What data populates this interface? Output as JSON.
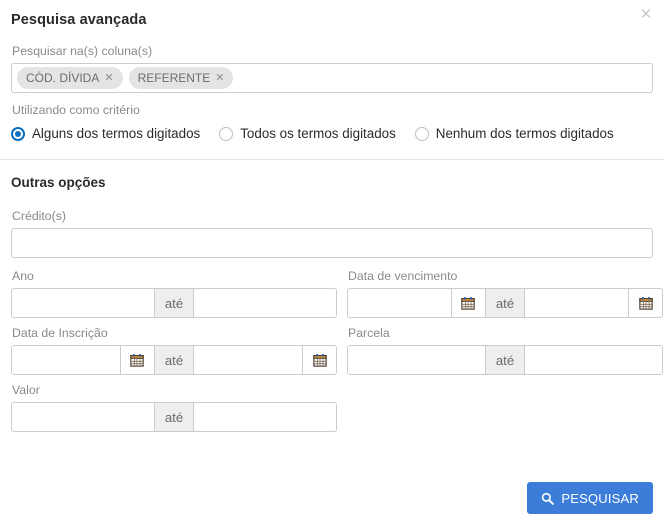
{
  "header": {
    "title": "Pesquisa avançada",
    "close_label": "✕"
  },
  "columns": {
    "label": "Pesquisar na(s) coluna(s)",
    "tags": [
      {
        "label": "CÓD. DÍVIDA",
        "remove": "✕"
      },
      {
        "label": "REFERENTE",
        "remove": "✕"
      }
    ]
  },
  "criteria": {
    "label": "Utilizando como critério",
    "options": [
      {
        "label": "Alguns dos termos digitados",
        "selected": true
      },
      {
        "label": "Todos os termos digitados",
        "selected": false
      },
      {
        "label": "Nenhum dos termos digitados",
        "selected": false
      }
    ]
  },
  "other": {
    "section_title": "Outras opções",
    "credito": {
      "label": "Crédito(s)",
      "value": "",
      "placeholder": ""
    },
    "ano": {
      "label": "Ano",
      "from": "",
      "to": "",
      "separator": "até"
    },
    "data_vencimento": {
      "label": "Data de vencimento",
      "from": "",
      "to": "",
      "separator": "até"
    },
    "data_inscricao": {
      "label": "Data de Inscrição",
      "from": "",
      "to": "",
      "separator": "até"
    },
    "parcela": {
      "label": "Parcela",
      "from": "",
      "to": "",
      "separator": "até"
    },
    "valor": {
      "label": "Valor",
      "from": "",
      "to": "",
      "separator": "até"
    }
  },
  "footer": {
    "search_label": "PESQUISAR"
  },
  "colors": {
    "primary": "#3b7dd8",
    "radio_accent": "#0a6ebd",
    "addon_bg": "#eeeeee",
    "border": "#cccccc",
    "tag_bg": "#e4e4e4"
  }
}
